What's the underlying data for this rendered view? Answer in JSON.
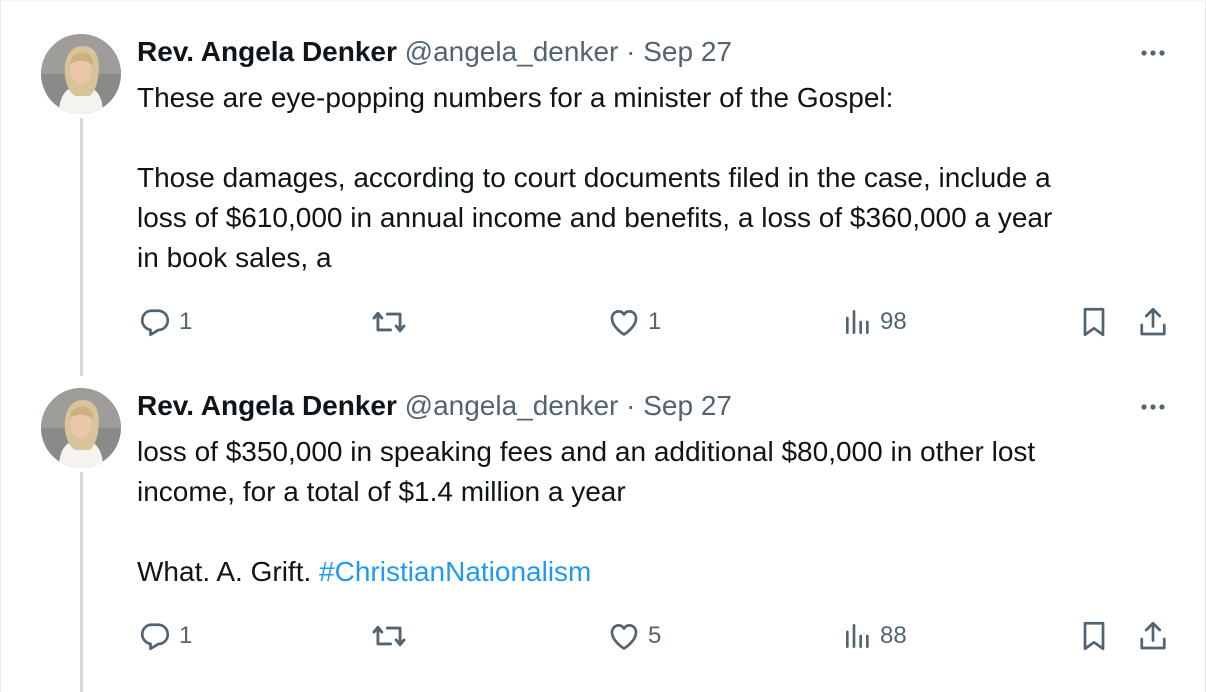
{
  "tweets": [
    {
      "author_name": "Rev. Angela Denker",
      "handle": "@angela_denker",
      "separator": "·",
      "date": "Sep 27",
      "lines": [
        "These are eye-popping numbers for a minister of the Gospel:",
        "",
        "Those damages, according to court documents filed in the case, include a",
        "loss of $610,000 in annual income and benefits, a loss of $360,000 a year",
        "in book sales, a"
      ],
      "replies": "1",
      "likes": "1",
      "views": "98"
    },
    {
      "author_name": "Rev. Angela Denker",
      "handle": "@angela_denker",
      "separator": "·",
      "date": "Sep 27",
      "line1": "loss of $350,000 in speaking fees and an additional $80,000 in other lost",
      "line2": "income, for a total of $1.4 million a year",
      "line3_text": "What. A. Grift. ",
      "hashtag": "#ChristianNationalism",
      "replies": "1",
      "likes": "5",
      "views": "88"
    }
  ],
  "icons": {
    "more": "more-horizontal-icon",
    "reply": "reply-icon",
    "retweet": "retweet-icon",
    "like": "heart-icon",
    "views": "views-icon",
    "bookmark": "bookmark-icon",
    "share": "share-icon"
  },
  "colors": {
    "text": "#0f1419",
    "secondary": "#536471",
    "link": "#1d9bf0",
    "thread_line": "#cfd9de"
  }
}
